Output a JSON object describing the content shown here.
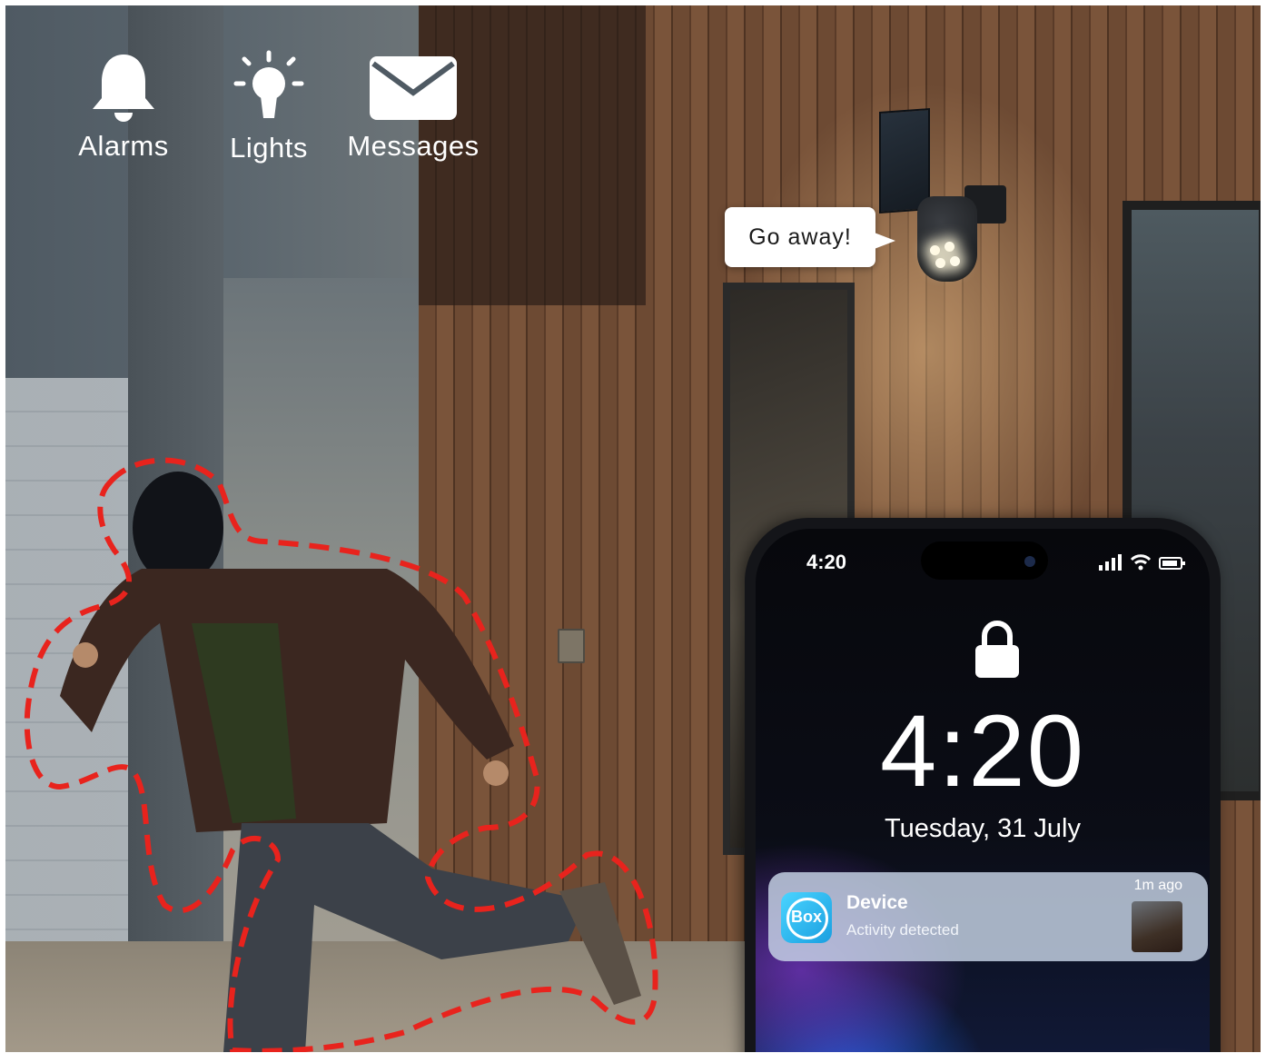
{
  "features": [
    {
      "icon": "bell-icon",
      "label": "Alarms"
    },
    {
      "icon": "lightbulb-icon",
      "label": "Lights"
    },
    {
      "icon": "envelope-icon",
      "label": "Messages"
    }
  ],
  "speech_bubble": {
    "text": "Go away!"
  },
  "phone": {
    "status_time": "4:20",
    "lock_time": "4:20",
    "date": "Tuesday, 31 July",
    "notification": {
      "app_icon_text": "Box",
      "title": "Device",
      "body": "Activity detected",
      "time": "1m ago"
    }
  },
  "colors": {
    "outline": "#e8231d",
    "notification_bg": "#c8d6e8",
    "app_icon": "#2bb8f0"
  }
}
